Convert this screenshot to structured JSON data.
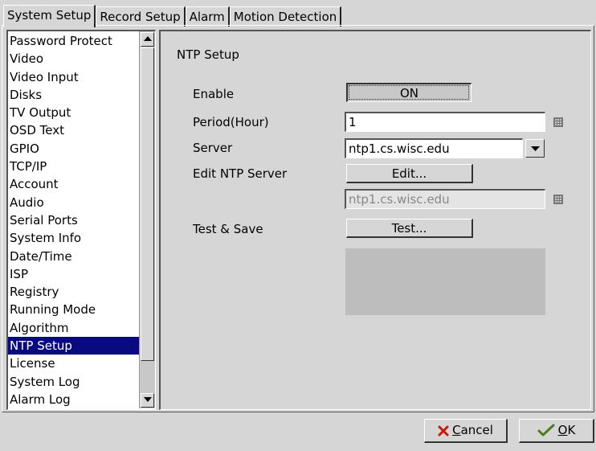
{
  "tabs": [
    {
      "label": "System Setup",
      "active": true
    },
    {
      "label": "Record Setup",
      "active": false
    },
    {
      "label": "Alarm",
      "active": false
    },
    {
      "label": "Motion Detection",
      "active": false
    }
  ],
  "sidebar": {
    "selected": "NTP Setup",
    "items": [
      "Password Protect",
      "Video",
      "Video Input",
      "Disks",
      "TV Output",
      "OSD Text",
      "GPIO",
      "TCP/IP",
      "Account",
      "Audio",
      "Serial Ports",
      "System Info",
      "Date/Time",
      "ISP",
      "Registry",
      "Running Mode",
      "Algorithm",
      "NTP Setup",
      "License",
      "System Log",
      "Alarm Log"
    ]
  },
  "ntp": {
    "title": "NTP Setup",
    "enable_label": "Enable",
    "enable_value": "ON",
    "period_label": "Period(Hour)",
    "period_value": "1",
    "server_label": "Server",
    "server_value": "ntp1.cs.wisc.edu",
    "edit_label": "Edit NTP Server",
    "edit_button": "Edit...",
    "edit_field_value": "ntp1.cs.wisc.edu",
    "test_label": "Test & Save",
    "test_button": "Test..."
  },
  "footer": {
    "cancel_label": "Cancel",
    "ok_label": "OK"
  },
  "colors": {
    "background": "#d6d6d6",
    "selection": "#0a0a80",
    "result_box": "#bdbdbd"
  },
  "icons": {
    "cancel": "red-x-icon",
    "ok": "green-check-icon",
    "keypad": "keypad-icon"
  }
}
